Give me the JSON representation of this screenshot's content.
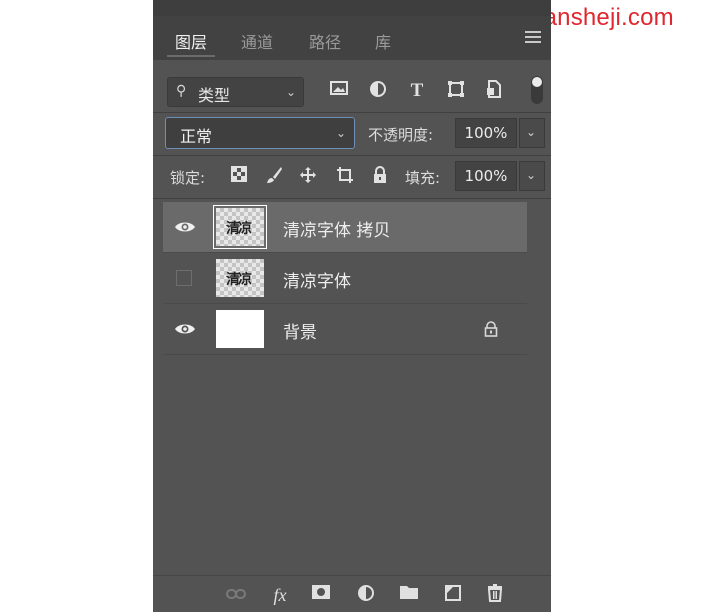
{
  "watermark": "www.haoyujiansheji.com",
  "tabs": [
    {
      "label": "图层",
      "active": true
    },
    {
      "label": "通道",
      "active": false
    },
    {
      "label": "路径",
      "active": false
    },
    {
      "label": "库",
      "active": false
    }
  ],
  "filter": {
    "label": "类型",
    "icons": [
      "image-filter-icon",
      "adjustment-filter-icon",
      "text-filter-icon",
      "shape-filter-icon",
      "smart-object-filter-icon"
    ]
  },
  "blend_mode": {
    "value": "正常"
  },
  "opacity": {
    "label": "不透明度:",
    "value": "100%"
  },
  "lock": {
    "label": "锁定:"
  },
  "fill": {
    "label": "填充:",
    "value": "100%"
  },
  "layers": [
    {
      "name": "清凉字体 拷贝",
      "visible": true,
      "selected": true,
      "thumb_glyph": "清凉"
    },
    {
      "name": "清凉字体",
      "visible": false,
      "selected": false,
      "thumb_glyph": "清凉"
    },
    {
      "name": "背景",
      "visible": true,
      "selected": false,
      "locked": true
    }
  ],
  "colors": {
    "panel": "#535353",
    "selected_row": "#6a6a6a",
    "watermark": "#e0262e",
    "focus_border": "#6e8fb8"
  }
}
